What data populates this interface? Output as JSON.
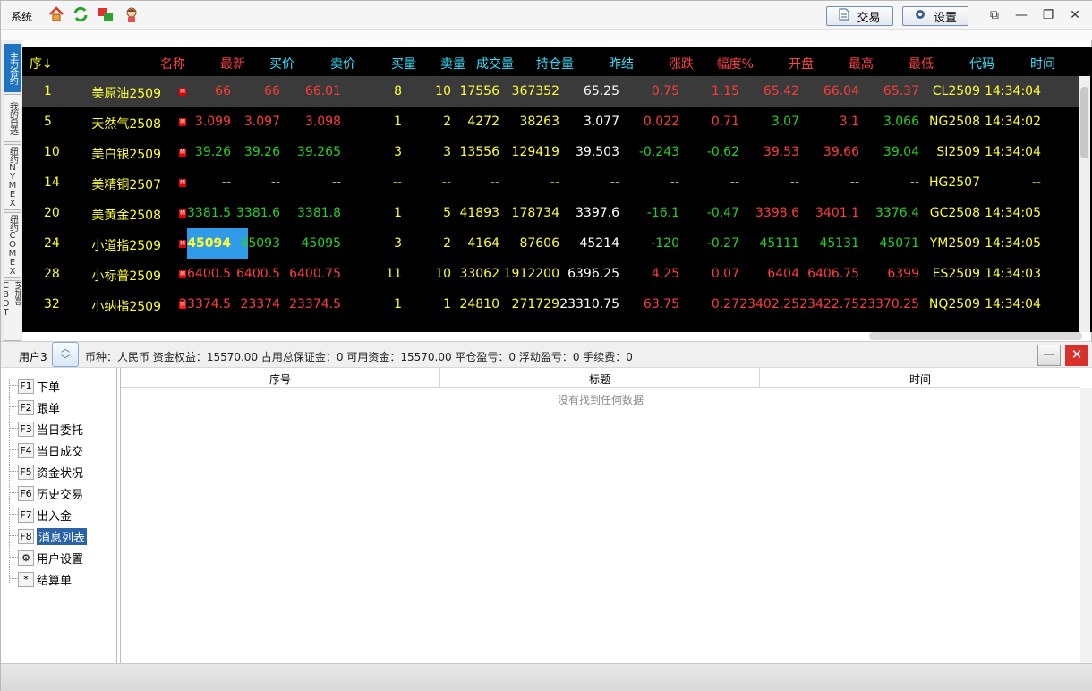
{
  "topbar": {
    "system_label": "系统",
    "trade_label": "交易",
    "settings_label": "设置"
  },
  "side_tabs": [
    "主力合约",
    "我的自选",
    "纽约NYMEX",
    "纽约COMEX",
    "芝加哥CBOT"
  ],
  "quote": {
    "headers": [
      "序↓",
      "名称",
      "最新",
      "买价",
      "卖价",
      "买量",
      "卖量",
      "成交量",
      "持仓量",
      "昨结",
      "涨跌",
      "幅度%",
      "开盘",
      "最高",
      "最低",
      "代码",
      "时间"
    ],
    "rows": [
      {
        "seq": "1",
        "name": "美原油2509",
        "last": "66",
        "bid": "66",
        "ask": "66.01",
        "bidvol": "8",
        "askvol": "10",
        "vol": "17556",
        "oi": "367352",
        "prev": "65.25",
        "chg": "0.75",
        "pct": "1.15",
        "open": "65.42",
        "high": "66.04",
        "low": "65.37",
        "code": "CL2509",
        "time": "14:34:04"
      },
      {
        "seq": "5",
        "name": "天然气2508",
        "last": "3.099",
        "bid": "3.097",
        "ask": "3.098",
        "bidvol": "1",
        "askvol": "2",
        "vol": "4272",
        "oi": "38263",
        "prev": "3.077",
        "chg": "0.022",
        "pct": "0.71",
        "open": "3.07",
        "high": "3.1",
        "low": "3.066",
        "code": "NG2508",
        "time": "14:34:02"
      },
      {
        "seq": "10",
        "name": "美白银2509",
        "last": "39.26",
        "bid": "39.26",
        "ask": "39.265",
        "bidvol": "3",
        "askvol": "3",
        "vol": "13556",
        "oi": "129419",
        "prev": "39.503",
        "chg": "-0.243",
        "pct": "-0.62",
        "open": "39.53",
        "high": "39.66",
        "low": "39.04",
        "code": "SI2509",
        "time": "14:34:04"
      },
      {
        "seq": "14",
        "name": "美精铜2507",
        "last": "--",
        "bid": "--",
        "ask": "--",
        "bidvol": "--",
        "askvol": "--",
        "vol": "--",
        "oi": "--",
        "prev": "--",
        "chg": "--",
        "pct": "--",
        "open": "--",
        "high": "--",
        "low": "--",
        "code": "HG2507",
        "time": "--"
      },
      {
        "seq": "20",
        "name": "美黄金2508",
        "last": "3381.5",
        "bid": "3381.6",
        "ask": "3381.8",
        "bidvol": "1",
        "askvol": "5",
        "vol": "41893",
        "oi": "178734",
        "prev": "3397.6",
        "chg": "-16.1",
        "pct": "-0.47",
        "open": "3398.6",
        "high": "3401.1",
        "low": "3376.4",
        "code": "GC2508",
        "time": "14:34:05"
      },
      {
        "seq": "24",
        "name": "小道指2509",
        "last": "45094",
        "bid": "45093",
        "ask": "45095",
        "bidvol": "3",
        "askvol": "2",
        "vol": "4164",
        "oi": "87606",
        "prev": "45214",
        "chg": "-120",
        "pct": "-0.27",
        "open": "45111",
        "high": "45131",
        "low": "45071",
        "code": "YM2509",
        "time": "14:34:05"
      },
      {
        "seq": "28",
        "name": "小标普2509",
        "last": "6400.5",
        "bid": "6400.5",
        "ask": "6400.75",
        "bidvol": "11",
        "askvol": "10",
        "vol": "33062",
        "oi": "1912200",
        "prev": "6396.25",
        "chg": "4.25",
        "pct": "0.07",
        "open": "6404",
        "high": "6406.75",
        "low": "6399",
        "code": "ES2509",
        "time": "14:34:03"
      },
      {
        "seq": "32",
        "name": "小纳指2509",
        "last": "23374.5",
        "bid": "23374",
        "ask": "23374.5",
        "bidvol": "1",
        "askvol": "1",
        "vol": "24810",
        "oi": "271729",
        "prev": "23310.75",
        "chg": "63.75",
        "pct": "0.27",
        "open": "23402.25",
        "high": "23422.75",
        "low": "23370.25",
        "code": "NQ2509",
        "time": "14:34:04"
      }
    ],
    "colors": {
      "up": "#ff3b3b",
      "down": "#25d025",
      "neutral": "#ffffff",
      "yellow": "#ffff33",
      "header_red": "#ff4040",
      "header_cyan": "#33e0ff",
      "highlight": "#2f9be8"
    }
  },
  "account": {
    "user": "用户3",
    "info": "币种：人民币   资金权益：15570.00   占用总保证金：0   可用资金：15570.00   平仓盈亏：0   浮动盈亏：0   手续费：0"
  },
  "tree": [
    {
      "key": "F1",
      "label": "下单"
    },
    {
      "key": "F2",
      "label": "跟单"
    },
    {
      "key": "F3",
      "label": "当日委托"
    },
    {
      "key": "F4",
      "label": "当日成交"
    },
    {
      "key": "F5",
      "label": "资金状况"
    },
    {
      "key": "F6",
      "label": "历史交易"
    },
    {
      "key": "F7",
      "label": "出入金"
    },
    {
      "key": "F8",
      "label": "消息列表"
    },
    {
      "key": "⚙",
      "label": "用户设置"
    },
    {
      "key": "*",
      "label": "结算单"
    }
  ],
  "messages": {
    "headers": [
      "序号",
      "标题",
      "时间"
    ],
    "empty_text": "没有找到任何数据"
  }
}
